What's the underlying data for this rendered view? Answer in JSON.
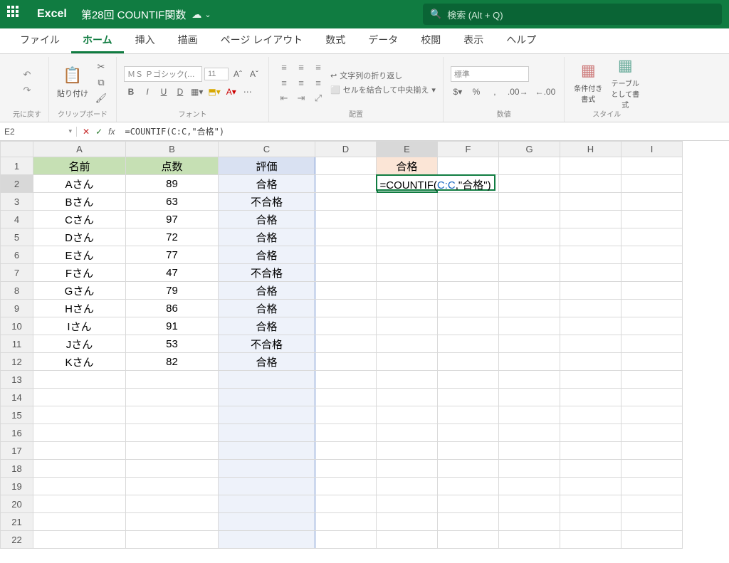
{
  "titlebar": {
    "app": "Excel",
    "doc": "第28回 COUNTIF関数",
    "search_placeholder": "検索 (Alt + Q)"
  },
  "tabs": [
    "ファイル",
    "ホーム",
    "挿入",
    "描画",
    "ページ レイアウト",
    "数式",
    "データ",
    "校閲",
    "表示",
    "ヘルプ"
  ],
  "active_tab_index": 1,
  "ribbon": {
    "undo_label": "元に戻す",
    "clipboard_label": "クリップボード",
    "paste_label": "貼り付け",
    "font_label": "フォント",
    "font_name": "ＭＳ Ｐゴシック(…",
    "font_size": "11",
    "align_label": "配置",
    "wrap_label": "文字列の折り返し",
    "merge_label": "セルを結合して中央揃え",
    "number_label": "数値",
    "number_format": "標準",
    "style_label": "スタイル",
    "cond_format": "条件付き書式",
    "table_format": "テーブルとして書式"
  },
  "namebox": "E2",
  "formula_text": "=COUNTIF(C:C,\"合格\")",
  "formula_display": {
    "pre": "=COUNTIF(",
    "ref": "C:C",
    "post": ",\"合格\")"
  },
  "columns": [
    "A",
    "B",
    "C",
    "D",
    "E",
    "F",
    "G",
    "H",
    "I"
  ],
  "header_row": {
    "A": "名前",
    "B": "点数",
    "C": "評価",
    "E": "合格"
  },
  "data_rows": [
    {
      "A": "Aさん",
      "B": "89",
      "C": "合格"
    },
    {
      "A": "Bさん",
      "B": "63",
      "C": "不合格"
    },
    {
      "A": "Cさん",
      "B": "97",
      "C": "合格"
    },
    {
      "A": "Dさん",
      "B": "72",
      "C": "合格"
    },
    {
      "A": "Eさん",
      "B": "77",
      "C": "合格"
    },
    {
      "A": "Fさん",
      "B": "47",
      "C": "不合格"
    },
    {
      "A": "Gさん",
      "B": "79",
      "C": "合格"
    },
    {
      "A": "Hさん",
      "B": "86",
      "C": "合格"
    },
    {
      "A": "Iさん",
      "B": "91",
      "C": "合格"
    },
    {
      "A": "Jさん",
      "B": "53",
      "C": "不合格"
    },
    {
      "A": "Kさん",
      "B": "82",
      "C": "合格"
    }
  ],
  "total_rows": 22,
  "active_cell": {
    "row": 2,
    "col": "E"
  }
}
